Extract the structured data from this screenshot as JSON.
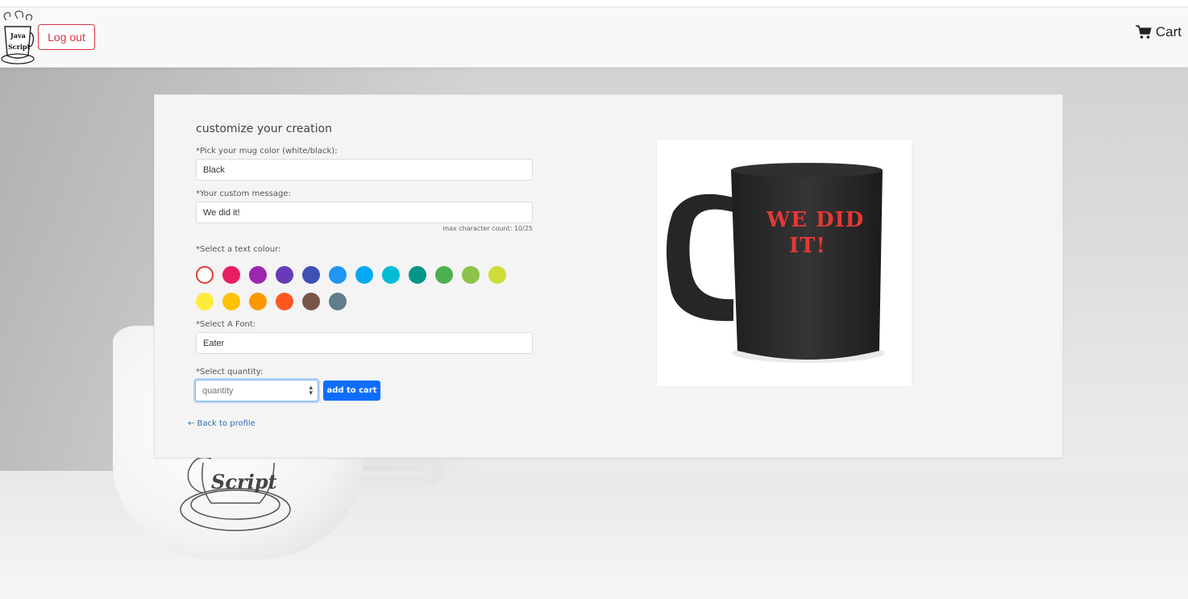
{
  "navbar": {
    "logout_label": "Log out",
    "cart_label": "Cart",
    "logo_text_top": "Java",
    "logo_text_bottom": "Script"
  },
  "form": {
    "title": "customize your creation",
    "mug_color_label": "*Pick your mug color (white/black):",
    "mug_color_value": "Black",
    "message_label": "*Your custom message:",
    "message_value": "We did it!",
    "char_count": "max character count: 10/25",
    "text_colour_label": "*Select a text colour:",
    "swatches": [
      {
        "name": "red",
        "color": "#e53935",
        "selected": true
      },
      {
        "name": "pink",
        "color": "#e91e63"
      },
      {
        "name": "purple",
        "color": "#9c27b0"
      },
      {
        "name": "deep-purple",
        "color": "#673ab7"
      },
      {
        "name": "indigo",
        "color": "#3f51b5"
      },
      {
        "name": "blue",
        "color": "#2196f3"
      },
      {
        "name": "light-blue",
        "color": "#03a9f4"
      },
      {
        "name": "cyan",
        "color": "#00bcd4"
      },
      {
        "name": "teal",
        "color": "#009688"
      },
      {
        "name": "green",
        "color": "#4caf50"
      },
      {
        "name": "light-green",
        "color": "#8bc34a"
      },
      {
        "name": "lime",
        "color": "#cddc39"
      },
      {
        "name": "yellow",
        "color": "#ffeb3b"
      },
      {
        "name": "amber",
        "color": "#ffc107"
      },
      {
        "name": "orange",
        "color": "#ff9800"
      },
      {
        "name": "deep-orange",
        "color": "#ff5722"
      },
      {
        "name": "brown",
        "color": "#795548"
      },
      {
        "name": "blue-grey",
        "color": "#607d8b"
      }
    ],
    "font_label": "*Select A Font:",
    "font_value": "Eater",
    "quantity_label": "*Select quantity:",
    "quantity_placeholder": "quantity",
    "add_to_cart_label": "add to cart",
    "back_link": "← Back to profile"
  },
  "preview": {
    "mug_color": "#2b2b2b",
    "text_color": "#e53935",
    "line1": "WE DID",
    "line2": "IT!"
  },
  "background": {
    "cup_text": "Script"
  }
}
